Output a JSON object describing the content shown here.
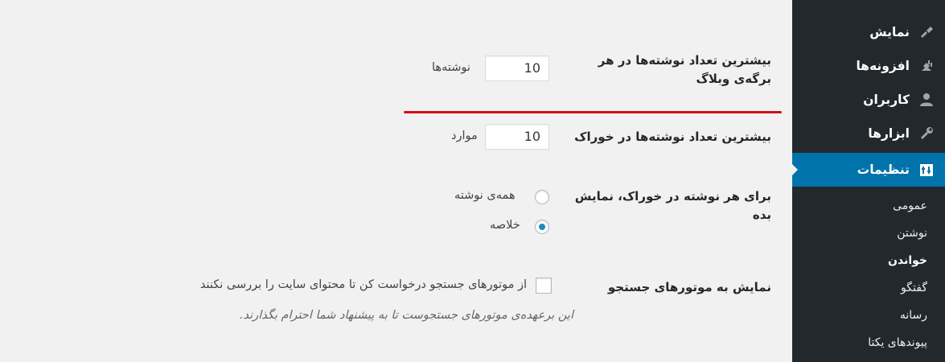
{
  "sidebar": {
    "items": [
      {
        "label": "نمایش",
        "icon": "paintbrush-icon"
      },
      {
        "label": "افزونه‌ها",
        "icon": "plugin-icon"
      },
      {
        "label": "کاربران",
        "icon": "user-icon"
      },
      {
        "label": "ابزارها",
        "icon": "wrench-icon"
      },
      {
        "label": "تنظیمات",
        "icon": "settings-icon"
      }
    ],
    "submenu": [
      {
        "label": "عمومی"
      },
      {
        "label": "نوشتن"
      },
      {
        "label": "خواندن"
      },
      {
        "label": "گفتگو"
      },
      {
        "label": "رسانه"
      },
      {
        "label": "پیوندهای یکتا"
      }
    ],
    "active_color": "#0073aa"
  },
  "settings": {
    "posts_per_page": {
      "label_line1": "بیشترین تعداد نوشته‌ها در هر",
      "label_line2": "برگه‌ی وبلاگ",
      "value": "10",
      "unit": "نوشته‌ها"
    },
    "posts_per_rss": {
      "label": "بیشترین تعداد نوشته‌ها در خوراک",
      "value": "10",
      "unit": "موارد"
    },
    "rss_use_excerpt": {
      "label_line1": "برای هر نوشته در خوراک، نمایش",
      "label_line2": "بده",
      "options": [
        {
          "label": "همه‌ی نوشته",
          "checked": false
        },
        {
          "label": "خلاصه",
          "checked": true
        }
      ]
    },
    "search_engine": {
      "label": "نمایش به موتورهای جستجو",
      "checkbox_label": "از موتورهای جستجو درخواست کن تا محتوای سایت را بررسی نکنند",
      "checked": false,
      "description": "این برعهده‌ی موتورهای جستجوست تا به پیشنهاد شما احترام بگذارند."
    }
  },
  "highlight_color": "#d40f14"
}
